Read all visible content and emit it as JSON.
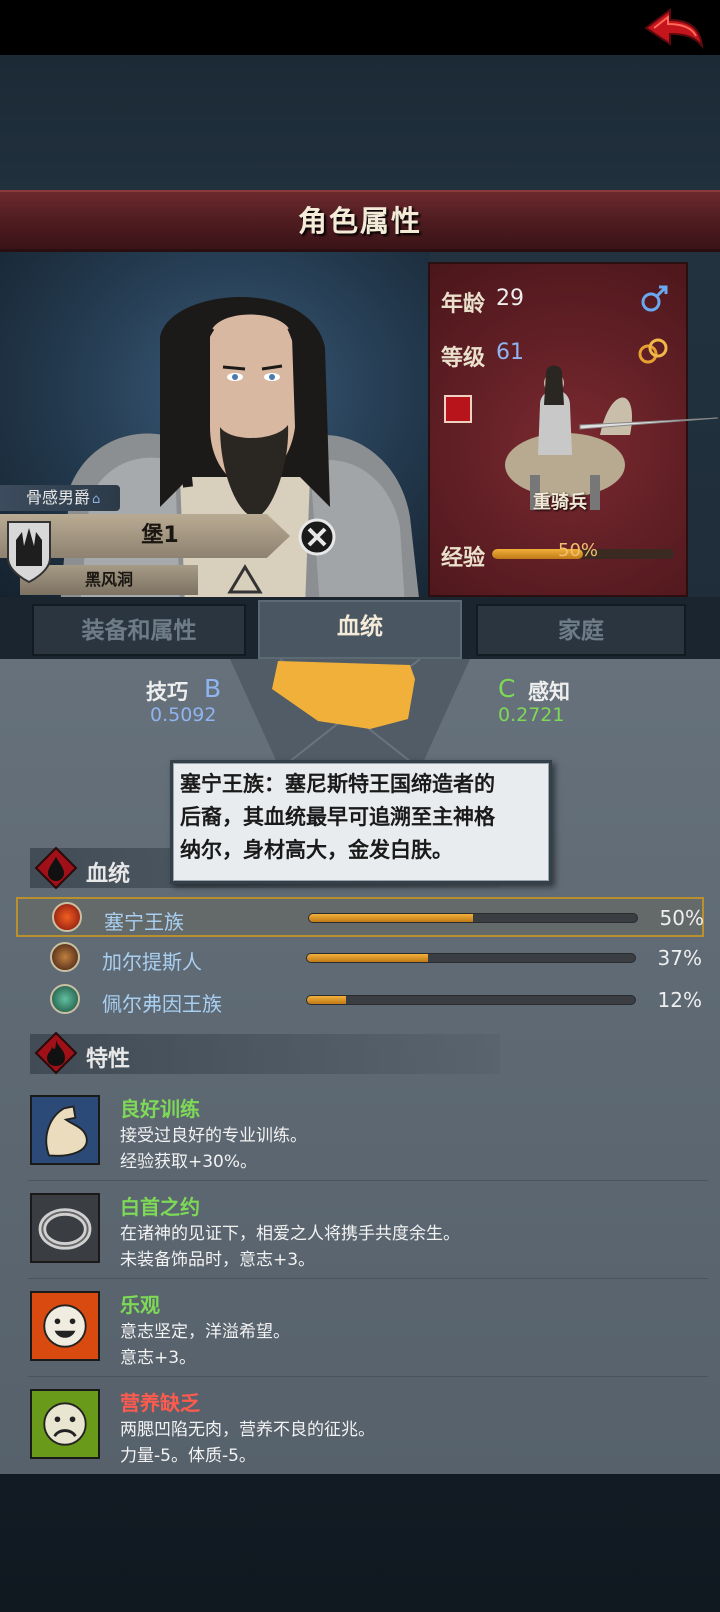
{
  "header": {
    "title": "角色属性"
  },
  "character": {
    "title": "骨感男爵",
    "name": "堡1",
    "home": "黑风洞"
  },
  "stats": {
    "age_label": "年龄",
    "age": "29",
    "level_label": "等级",
    "level": "61",
    "unit": "重骑兵",
    "exp_label": "经验",
    "exp_pct": "50%",
    "exp_fraction": 0.5
  },
  "tabs": [
    {
      "label": "装备和属性",
      "active": false
    },
    {
      "label": "血统",
      "active": true
    },
    {
      "label": "家庭",
      "active": false
    }
  ],
  "attributes": {
    "left": {
      "name": "技巧",
      "grade": "B",
      "value": "0.5092"
    },
    "right": {
      "name": "感知",
      "grade": "C",
      "value": "0.2721"
    }
  },
  "tooltip": {
    "line1": "塞宁王族：塞尼斯特王国缔造者的",
    "line2": "后裔，其血统最早可追溯至主神格",
    "line3": "纳尔，身材高大，金发白肤。"
  },
  "lineage_section": {
    "title": "血统"
  },
  "lineages": [
    {
      "name": "塞宁王族",
      "pct": "50%",
      "fraction": 0.5
    },
    {
      "name": "加尔提斯人",
      "pct": "37%",
      "fraction": 0.37
    },
    {
      "name": "佩尔弗因王族",
      "pct": "12%",
      "fraction": 0.12
    }
  ],
  "traits_section": {
    "title": "特性"
  },
  "traits": [
    {
      "name": "良好训练",
      "desc1": "接受过良好的专业训练。",
      "desc2": "经验获取+30%。",
      "color": "#7ed957"
    },
    {
      "name": "白首之约",
      "desc1": "在诸神的见证下，相爱之人将携手共度余生。",
      "desc2": "未装备饰品时，意志+3。",
      "color": "#7ed957"
    },
    {
      "name": "乐观",
      "desc1": "意志坚定，洋溢希望。",
      "desc2": "意志+3。",
      "color": "#7ed957"
    },
    {
      "name": "营养缺乏",
      "desc1": "两腮凹陷无肉，营养不良的征兆。",
      "desc2": "力量-5。体质-5。",
      "color": "#ff5a4e"
    }
  ],
  "colors": {
    "accent_gold": "#f1b03a",
    "header_red": "#6b2a2e",
    "good_trait": "#7ed957",
    "bad_trait": "#ff5a4e"
  }
}
